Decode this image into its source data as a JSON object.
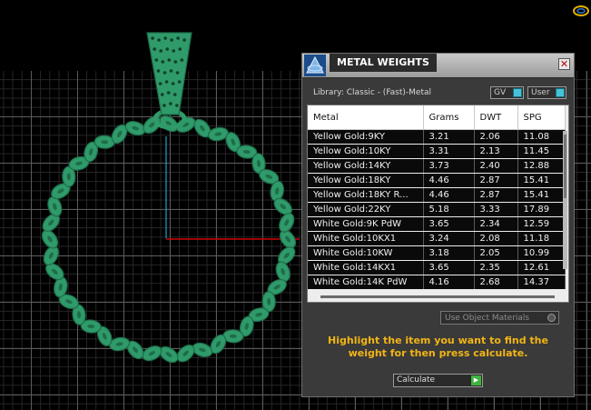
{
  "panel": {
    "title": "METAL WEIGHTS",
    "close_glyph": "✕",
    "library_label": "Library: Classic - (Fast)-Metal",
    "toggles": {
      "gv": "GV",
      "user": "User"
    },
    "table": {
      "headers": [
        "Metal",
        "Grams",
        "DWT",
        "SPG"
      ],
      "rows": [
        [
          "Yellow Gold:9KY",
          "3.21",
          "2.06",
          "11.08"
        ],
        [
          "Yellow Gold:10KY",
          "3.31",
          "2.13",
          "11.45"
        ],
        [
          "Yellow Gold:14KY",
          "3.73",
          "2.40",
          "12.88"
        ],
        [
          "Yellow Gold:18KY",
          "4.46",
          "2.87",
          "15.41"
        ],
        [
          "Yellow Gold:18KY R...",
          "4.46",
          "2.87",
          "15.41"
        ],
        [
          "Yellow Gold:22KY",
          "5.18",
          "3.33",
          "17.89"
        ],
        [
          "White Gold:9K PdW",
          "3.65",
          "2.34",
          "12.59"
        ],
        [
          "White Gold:10KX1",
          "3.24",
          "2.08",
          "11.18"
        ],
        [
          "White Gold:10KW",
          "3.18",
          "2.05",
          "10.99"
        ],
        [
          "White Gold:14KX1",
          "3.65",
          "2.35",
          "12.61"
        ],
        [
          "White Gold:14K PdW",
          "4.16",
          "2.68",
          "14.37"
        ]
      ]
    },
    "materials_dropdown": "Use Object Materials",
    "hint": "Highlight the item you want to find the weight for then press calculate.",
    "calculate_label": "Calculate"
  },
  "colors": {
    "model": "#2f9a6a",
    "model_dark": "#1e6d4a",
    "hint": "#f2b515",
    "axis_x": "#d00000",
    "axis_y": "#1aa3c8"
  },
  "icons": {
    "panel": "rhino-app-icon",
    "gizmo": "gumball-gizmo-icon",
    "go": "play-arrow-icon"
  }
}
